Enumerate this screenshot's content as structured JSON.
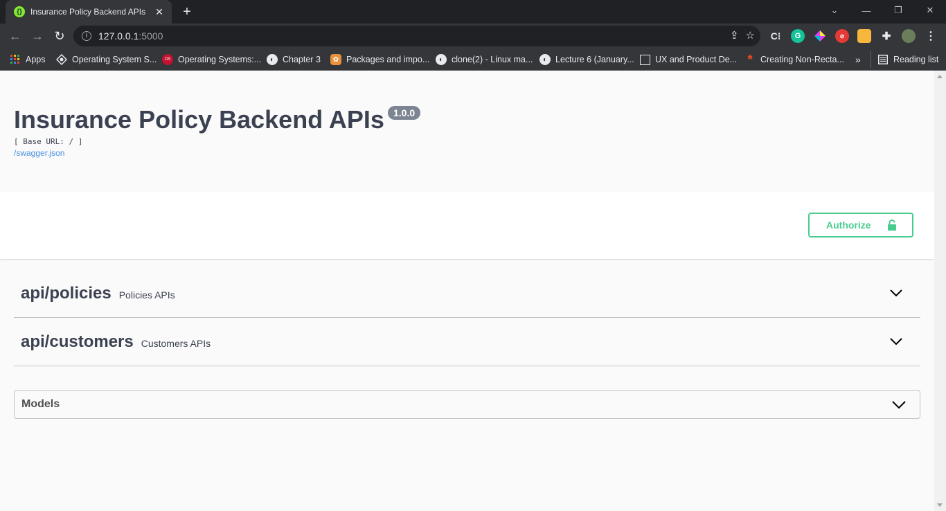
{
  "browser": {
    "tab_title": "Insurance Policy Backend APIs",
    "tab_favicon": "swagger-icon",
    "url_host": "127.0.0.1",
    "url_port": ":5000",
    "bookmarks": [
      {
        "label": "Apps",
        "icon": "apps-grid-icon"
      },
      {
        "label": "Operating System S...",
        "icon": "os-logo-icon"
      },
      {
        "label": "Operating Systems:...",
        "icon": "red-circle-icon"
      },
      {
        "label": "Chapter 3",
        "icon": "globe-icon"
      },
      {
        "label": "Packages and impo...",
        "icon": "python-logo-icon"
      },
      {
        "label": "clone(2) - Linux ma...",
        "icon": "globe-icon"
      },
      {
        "label": "Lecture 6 (January...",
        "icon": "globe-icon"
      },
      {
        "label": "UX and Product De...",
        "icon": "blank-page-icon"
      },
      {
        "label": "Creating Non-Recta...",
        "icon": "asterisk-icon"
      }
    ],
    "more_bookmarks": "»",
    "reading_list": "Reading list"
  },
  "info": {
    "title": "Insurance Policy Backend APIs",
    "version": "1.0.0",
    "base_url": "[ Base URL: / ]",
    "spec_link": "/swagger.json"
  },
  "scheme": {
    "authorize_label": "Authorize"
  },
  "tags": [
    {
      "name": "api/policies",
      "description": "Policies APIs"
    },
    {
      "name": "api/customers",
      "description": "Customers APIs"
    }
  ],
  "models": {
    "title": "Models"
  },
  "colors": {
    "authorize": "#49cc90",
    "text": "#3b4151",
    "version_badge": "#7d8492",
    "link": "#4990e2"
  }
}
